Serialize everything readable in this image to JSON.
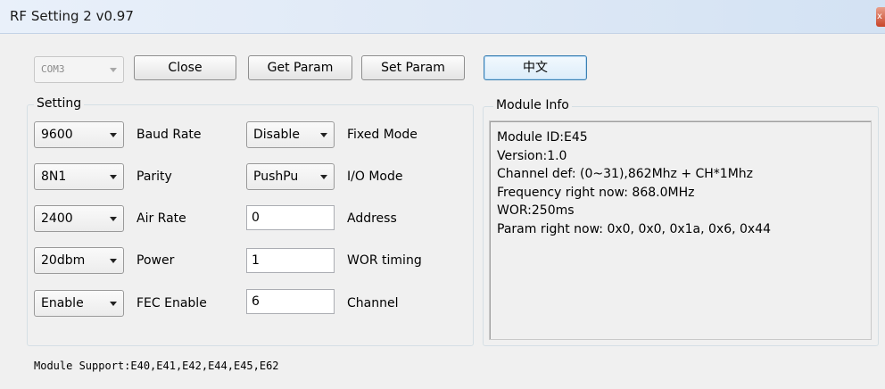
{
  "window": {
    "title": "RF Setting 2 v0.97",
    "close_glyph": "x"
  },
  "toolbar": {
    "com_port": "COM3",
    "close_label": "Close",
    "get_param_label": "Get Param",
    "set_param_label": "Set Param",
    "language_label": "中文"
  },
  "setting": {
    "title": "Setting",
    "baud_rate": {
      "value": "9600",
      "label": "Baud Rate"
    },
    "parity": {
      "value": "8N1",
      "label": "Parity"
    },
    "air_rate": {
      "value": "2400",
      "label": "Air Rate"
    },
    "power": {
      "value": "20dbm",
      "label": "Power"
    },
    "fec": {
      "value": "Enable",
      "label": "FEC Enable"
    },
    "fixed_mode": {
      "value": "Disable",
      "label": "Fixed Mode"
    },
    "io_mode": {
      "value": "PushPu",
      "label": "I/O Mode"
    },
    "address": {
      "value": "0",
      "label": "Address"
    },
    "wor_timing": {
      "value": "1",
      "label": "WOR timing"
    },
    "channel": {
      "value": "6",
      "label": "Channel"
    }
  },
  "module_info": {
    "title": "Module Info",
    "lines": [
      "Module ID:E45",
      "Version:1.0",
      "Channel def: (0~31),862Mhz + CH*1Mhz",
      "Frequency right now: 868.0MHz",
      "WOR:250ms",
      "Param right now: 0x0, 0x0, 0x1a, 0x6, 0x44"
    ]
  },
  "footer": {
    "support": "Module Support:E40,E41,E42,E44,E45,E62"
  }
}
